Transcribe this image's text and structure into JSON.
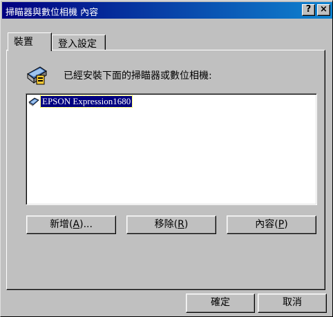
{
  "window": {
    "title": "掃瞄器與數位相機 內容"
  },
  "title_buttons": {
    "help": "?",
    "close": "×"
  },
  "tabs": [
    {
      "label": "裝置",
      "active": true
    },
    {
      "label": "登入設定",
      "active": false
    }
  ],
  "panel": {
    "header_icon": "scanner-icon",
    "header_label": "已經安裝下面的掃瞄器或數位相機:"
  },
  "device_list": {
    "items": [
      {
        "label": "EPSON Expression1680",
        "icon": "scanner-arrow-icon",
        "selected": true
      }
    ]
  },
  "device_buttons": {
    "add": {
      "text": "新增(",
      "key": "A",
      "suffix": ")..."
    },
    "remove": {
      "text": "移除(",
      "key": "R",
      "suffix": ")"
    },
    "properties": {
      "text": "內容(",
      "key": "P",
      "suffix": ")"
    }
  },
  "dialog_buttons": {
    "ok": "確定",
    "cancel": "取消"
  },
  "colors": {
    "titlebar_start": "#000080",
    "titlebar_end": "#1084d0",
    "face": "#c0c0c0",
    "selection": "#000080"
  }
}
